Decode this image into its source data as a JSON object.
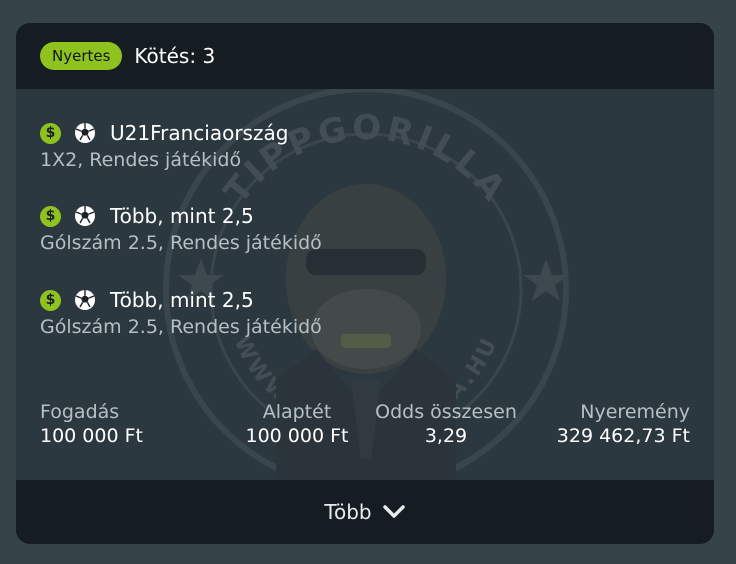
{
  "header": {
    "status": "Nyertes",
    "bet_count": "Kötés: 3"
  },
  "watermark": {
    "text_top": "TIPPGORILLA",
    "text_bottom": "WWW.TIPPGORILLA.HU"
  },
  "selections": [
    {
      "icon": "dollar-icon",
      "sport_icon": "soccer-ball-icon",
      "name": "U21Franciaország",
      "market": "1X2, Rendes játékidő"
    },
    {
      "icon": "dollar-icon",
      "sport_icon": "soccer-ball-icon",
      "name": "Több, mint 2,5",
      "market": "Gólszám 2.5, Rendes játékidő"
    },
    {
      "icon": "dollar-icon",
      "sport_icon": "soccer-ball-icon",
      "name": "Több, mint 2,5",
      "market": "Gólszám 2.5, Rendes játékidő"
    }
  ],
  "summary": {
    "stake": {
      "label": "Fogadás",
      "value": "100 000 Ft"
    },
    "base_stake": {
      "label": "Alaptét",
      "value": "100 000 Ft"
    },
    "total_odds": {
      "label": "Odds összesen",
      "value": "3,29"
    },
    "winnings": {
      "label": "Nyeremény",
      "value": "329 462,73 Ft"
    }
  },
  "footer": {
    "more_label": "Több",
    "icon": "chevron-down-icon"
  },
  "colors": {
    "accent": "#8dc21f",
    "header_bg": "#161d22",
    "body_bg": "#2c383f",
    "page_bg": "#364349"
  }
}
